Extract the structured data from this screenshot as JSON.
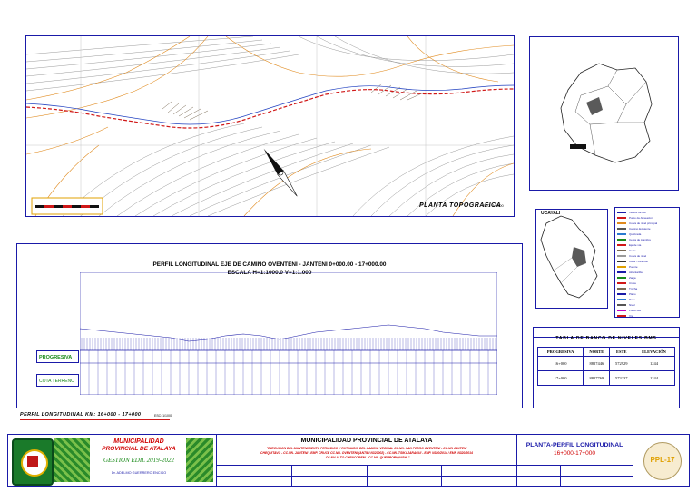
{
  "colors": {
    "frame": "#1a1aa8",
    "terrain": "#e08a1e",
    "road": "#d01818",
    "green": "#1a8a1a",
    "title_red": "#d00000"
  },
  "plan": {
    "title": "PLANTA TOPOGRAFICA",
    "scale": "ESC: 1/1000"
  },
  "profile": {
    "title_line1": "PERFIL LONGITUDINAL EJE DE CAMINO OVENTENI - JANTENI 0+000.00 - 17+000.00",
    "title_line2": "ESCALA H=1:1000.0 V=1:1.000",
    "row_progresiva": "PROGRESIVA",
    "row_cota": "COTA TERRENO",
    "caption": "PERFIL LONGITUDINAL KM: 16+000 - 17+000",
    "caption_scale": "ESC: 1/1000"
  },
  "location": {
    "peru_label": "UCAYALI"
  },
  "bm_table": {
    "title": "TABLA DE BANCO DE NIVELES BMS",
    "headers": [
      "PROGRESIVA",
      "NORTE",
      "ESTE",
      "ELEVACIÓN"
    ],
    "rows": [
      [
        "16+000",
        "8827446",
        "572929",
        "1244"
      ],
      [
        "17+000",
        "8827769",
        "573237",
        "1244"
      ]
    ]
  },
  "title_block": {
    "municipality_left_1": "MUNICIPALIDAD",
    "municipality_left_2": "PROVINCIAL DE ATALAYA",
    "gestion": "GESTION EDIL 2019-2022",
    "mayor": "Dr. ADELMO GUERRERO ENCISO",
    "main_title": "MUNICIPALIDAD PROVINCIAL DE ATALAYA",
    "project_1": "\"EJECUCION DEL MANTENIMIENTO PERIODICO Y RUTINARIO DEL CAMINO VECINAL CC.NN. SAN PEDRO OVENTENI - CC.NN JANTENI",
    "project_2": "CHEQUITAVO - CC.NN. JANTENI - EMP. CRUCE CC.NN. OVENTENI (ANTIBI N320002) - CC.NN. TSIKAJARAGUI - EMP. N320/2014 / EMP. N320/2014",
    "project_3": "- CC.NN.ALTO CHENCORENI - CC.NN. QUEMPORIQUISHI \"",
    "sheet_title": "PLANTA-PERFIL LONGITUDINAL",
    "sheet_range": "16+000-17+000",
    "sheet_code": "PPL-17"
  },
  "legend_items": [
    "Vértice de BM",
    "Punto de Alineación",
    "Curva de nivel principal",
    "Camino Existente",
    "Quebrada",
    "Cerca de Alambre",
    "Eje de vía",
    "Cerro",
    "Curva de nivel",
    "Casa / vivienda",
    "Puente",
    "Alcantarilla",
    "Zanja",
    "Cruce",
    "Trocha",
    "Plano",
    "Pozo",
    "Nivel",
    "Punto BM",
    "Vía"
  ]
}
